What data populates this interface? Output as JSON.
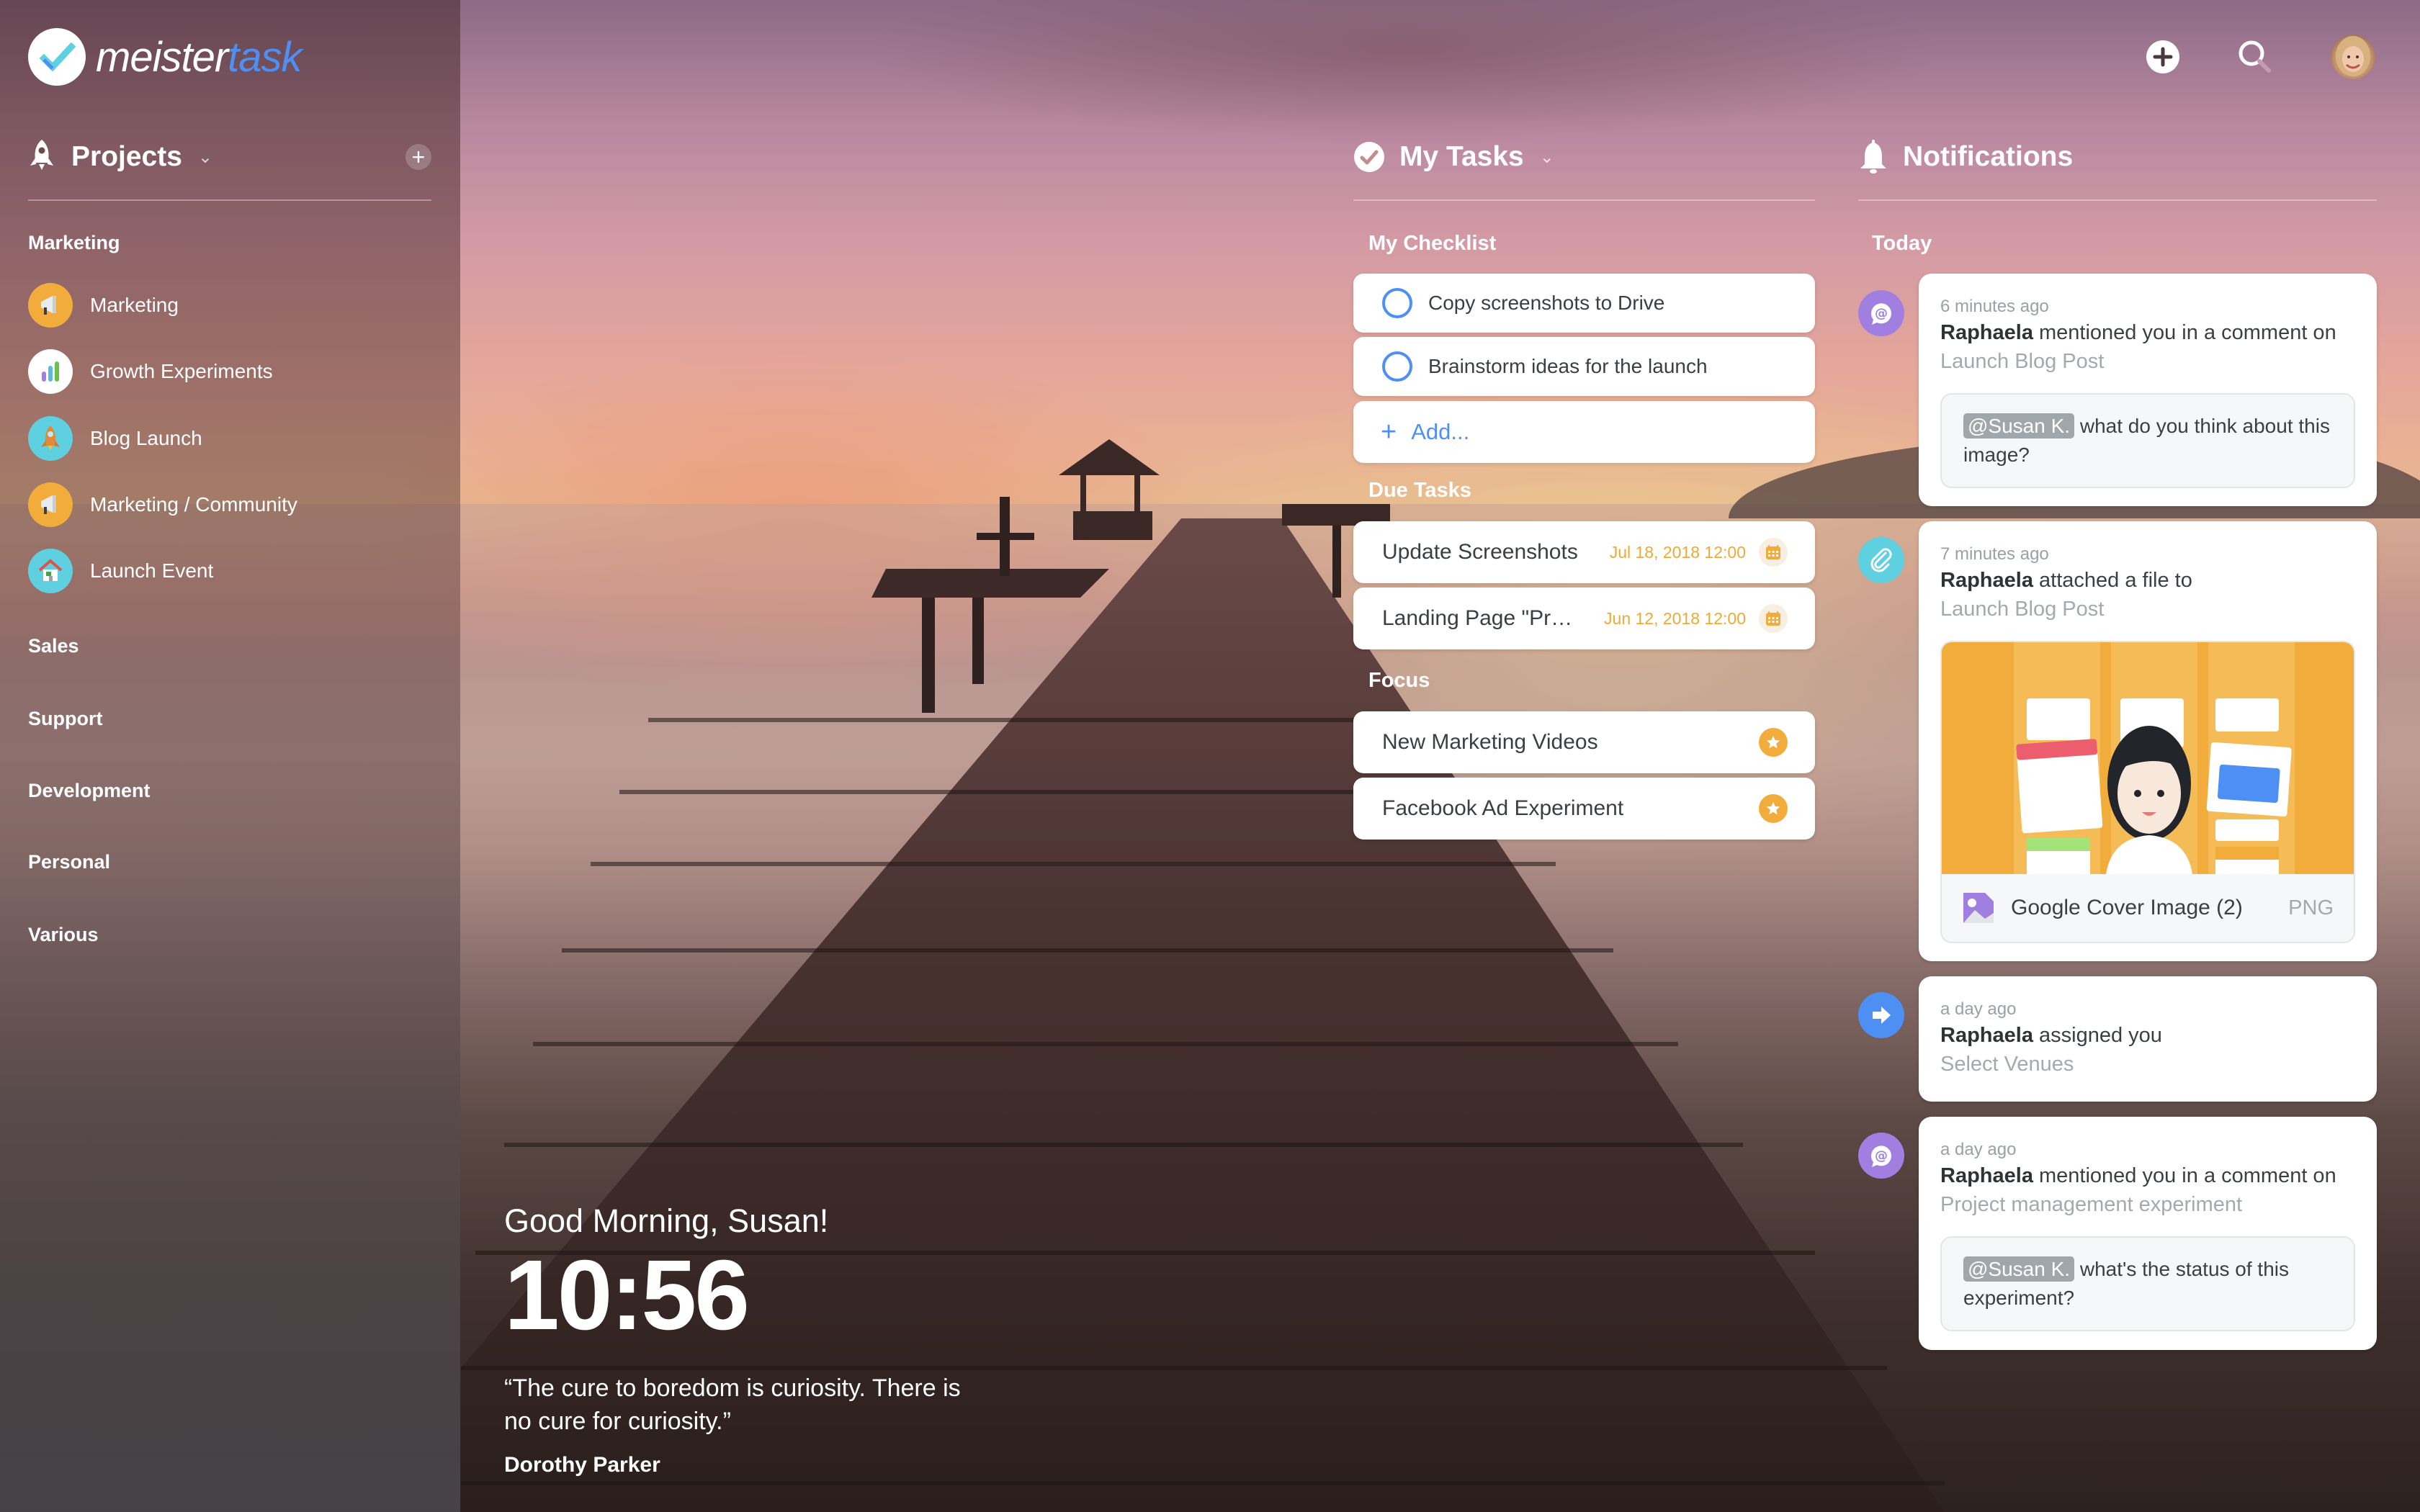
{
  "app": {
    "logo_part1": "meister",
    "logo_part2": "task",
    "brand_color": "#4d8ff3",
    "accent_orange": "#f2ac3c"
  },
  "topbar": {
    "add_icon": "plus-circle-icon",
    "search_icon": "search-icon",
    "avatar": "user-avatar"
  },
  "sidebar": {
    "header": "Projects",
    "add_icon": "plus-icon",
    "groups": [
      {
        "label": "Marketing",
        "items": [
          {
            "label": "Marketing",
            "icon": "megaphone-icon",
            "icon_bg": "#f2ac3c"
          },
          {
            "label": "Growth Experiments",
            "icon": "bar-chart-icon",
            "icon_bg": "#ffffff"
          },
          {
            "label": "Blog Launch",
            "icon": "rocket-icon",
            "icon_bg": "#5fd0e0"
          },
          {
            "label": "Marketing / Community",
            "icon": "megaphone-icon",
            "icon_bg": "#f2ac3c"
          },
          {
            "label": "Launch Event",
            "icon": "house-icon",
            "icon_bg": "#5fd0e0"
          }
        ]
      },
      {
        "label": "Sales"
      },
      {
        "label": "Support"
      },
      {
        "label": "Development"
      },
      {
        "label": "Personal"
      },
      {
        "label": "Various"
      }
    ]
  },
  "my_tasks": {
    "header": "My Tasks",
    "checklist_label": "My Checklist",
    "checklist": [
      {
        "label": "Copy screenshots to Drive",
        "checked": false
      },
      {
        "label": "Brainstorm ideas for the launch",
        "checked": false
      }
    ],
    "add_label": "Add...",
    "due_label": "Due Tasks",
    "due": [
      {
        "label": "Update Screenshots",
        "date": "Jul 18, 2018 12:00"
      },
      {
        "label": "Landing Page \"Pr…",
        "date": "Jun 12, 2018 12:00"
      }
    ],
    "focus_label": "Focus",
    "focus": [
      {
        "label": "New Marketing Videos"
      },
      {
        "label": "Facebook Ad Experiment"
      }
    ]
  },
  "notifications": {
    "header": "Notifications",
    "today_label": "Today",
    "items": [
      {
        "type": "mention",
        "icon_bg": "#a07fe0",
        "time": "6 minutes ago",
        "actor": "Raphaela",
        "action": " mentioned you in a comment on",
        "target": "Launch Blog Post",
        "mention": "@Susan K.",
        "comment": " what do you think about this image?"
      },
      {
        "type": "attachment",
        "icon_bg": "#5fd0e0",
        "time": "7 minutes ago",
        "actor": "Raphaela",
        "action": " attached a file to",
        "target": "Launch Blog Post",
        "file_name": "Google Cover Image (2)",
        "file_type": "PNG"
      },
      {
        "type": "assign",
        "icon_bg": "#4d8ff3",
        "time": "a day ago",
        "actor": "Raphaela",
        "action": " assigned you",
        "target": "Select Venues"
      },
      {
        "type": "mention",
        "icon_bg": "#a07fe0",
        "time": "a day ago",
        "actor": "Raphaela",
        "action": " mentioned you in a comment on",
        "target": "Project management experiment",
        "mention": "@Susan K.",
        "comment": " what's the status of this experiment?"
      }
    ]
  },
  "greeting": {
    "text": "Good Morning, Susan!",
    "time": "10:56",
    "quote": "“The cure to boredom is curiosity. There is no cure for curiosity.”",
    "author": "Dorothy Parker"
  }
}
